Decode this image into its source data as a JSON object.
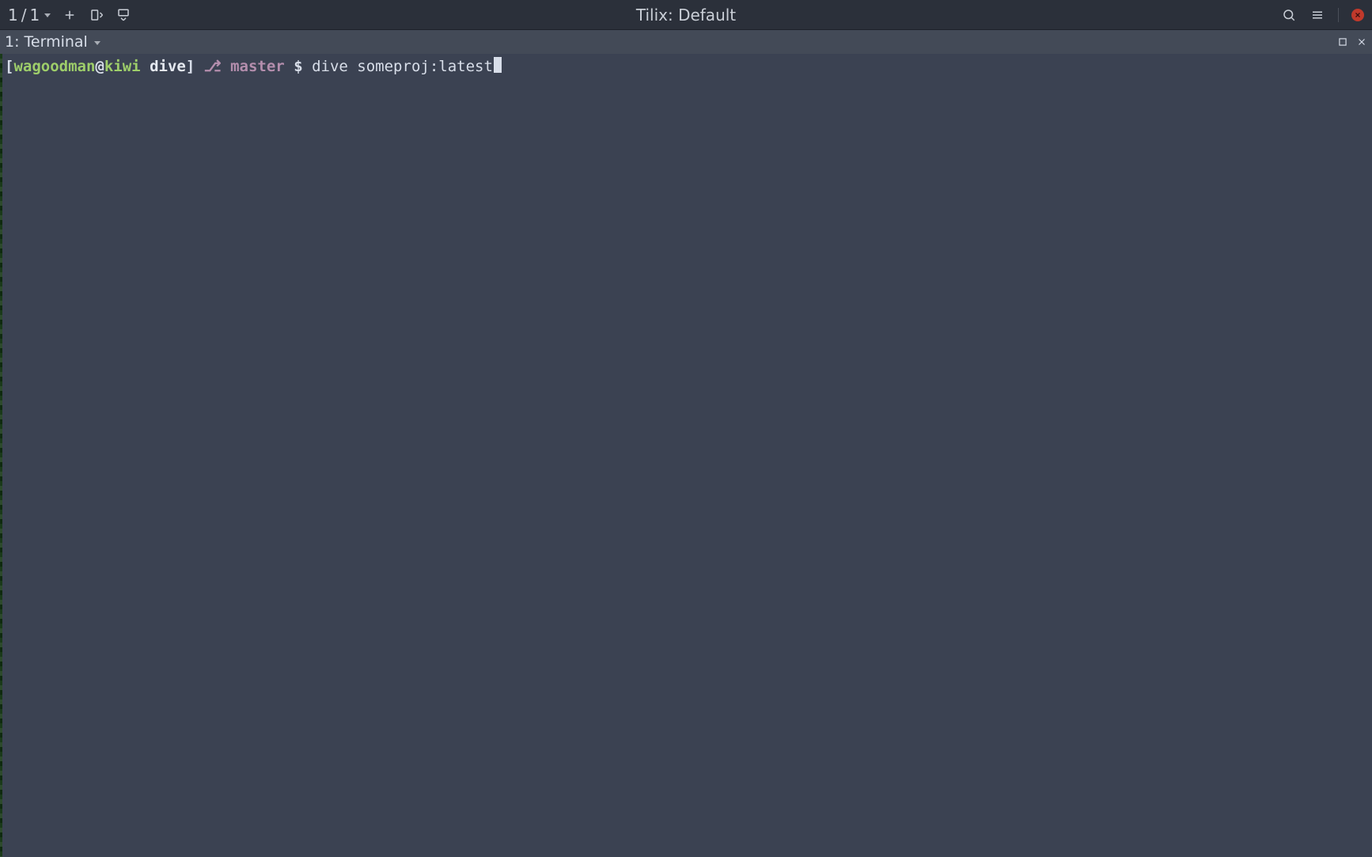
{
  "window": {
    "title": "Tilix: Default",
    "session_current": "1",
    "session_total": "1"
  },
  "tab": {
    "label": "1: Terminal"
  },
  "prompt": {
    "open_bracket": "[",
    "user": "wagoodman",
    "at": "@",
    "host": "kiwi",
    "space1": " ",
    "dir": "dive",
    "close_bracket": "]",
    "space2": " ",
    "branch_glyph": "⎇",
    "space3": " ",
    "branch": "master",
    "space4": " ",
    "dollar": "$",
    "space5": " ",
    "command": "dive someproj:latest"
  },
  "colors": {
    "bg_toolbar": "#2b303a",
    "bg_tab": "#434a57",
    "bg_terminal": "#3b4252",
    "fg": "#d8dee9",
    "green": "#9ece6a",
    "purple": "#b48ead",
    "close_red": "#c0392b"
  }
}
